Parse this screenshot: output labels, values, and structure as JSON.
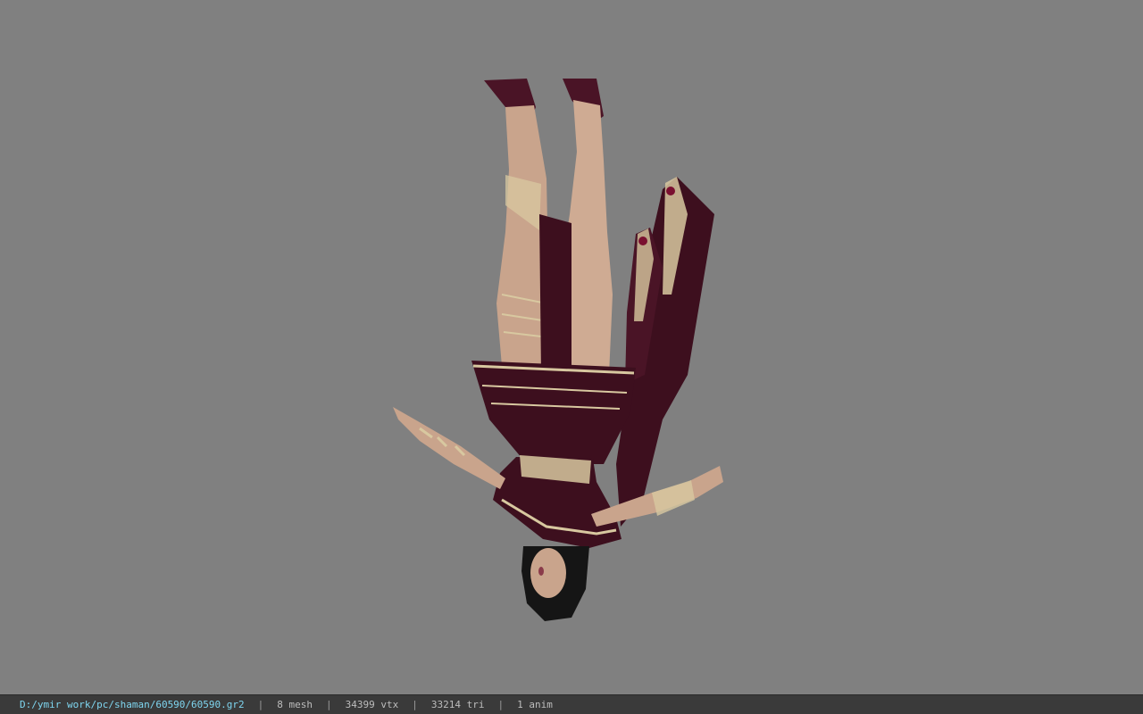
{
  "viewport": {
    "background": "#808080",
    "model": {
      "name": "character-model",
      "orientation": "upside-down",
      "dress_color": "#3d0f1e",
      "skin_color": "#c9a48c",
      "trim_color": "#d8c8a0",
      "hair_color": "#151515"
    }
  },
  "status_bar": {
    "file_path": "D:/ymir work/pc/shaman/60590/60590.gr2",
    "separator": "|",
    "mesh": "8 mesh",
    "vtx": "34399 vtx",
    "tri": "33214 tri",
    "anim": "1 anim",
    "file_color": "#7fd6f0",
    "background": "#3a3a3a"
  }
}
